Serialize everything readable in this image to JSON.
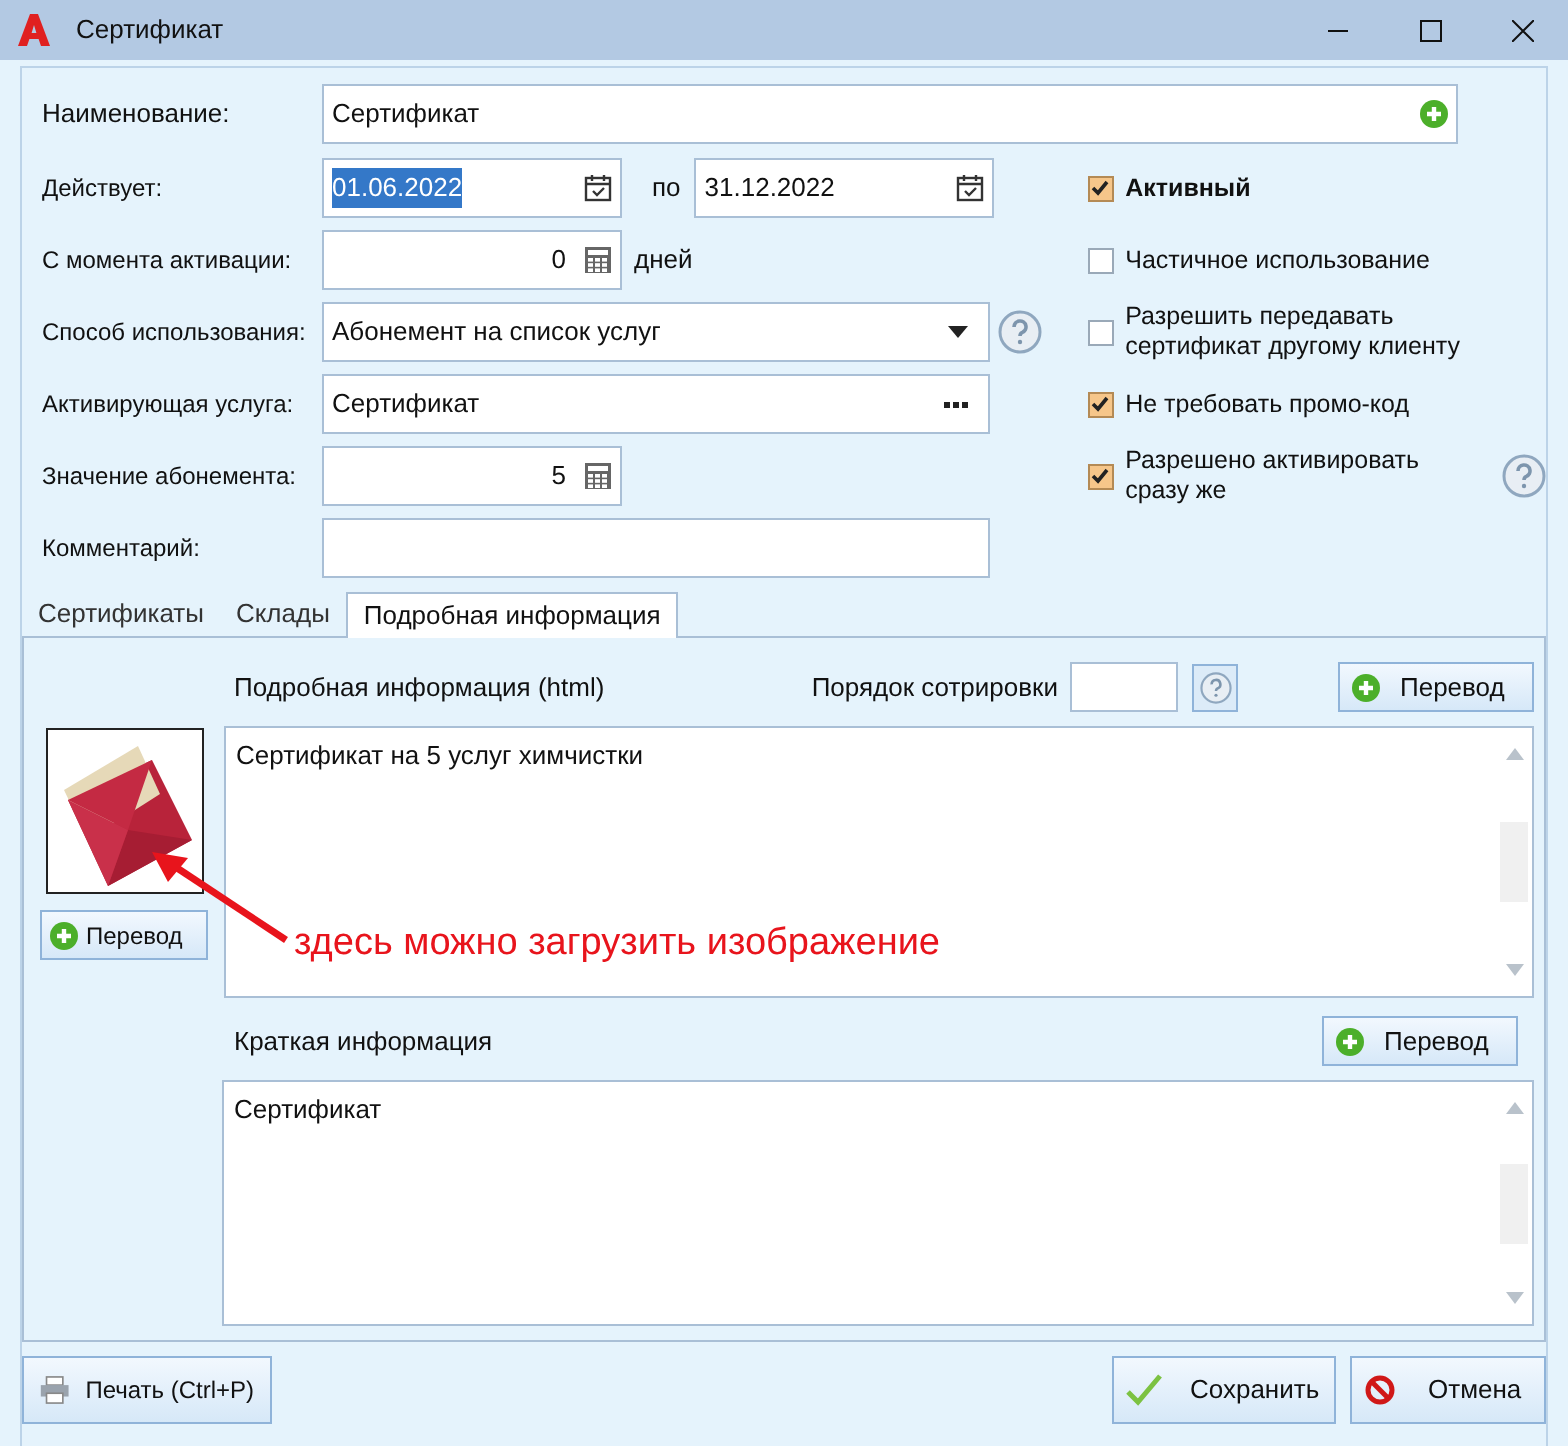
{
  "window": {
    "title": "Сертификат"
  },
  "name_field": {
    "label": "Наименование:",
    "value": "Сертификат"
  },
  "fields": [
    {
      "kind": "daterange",
      "label": "Действует:",
      "from": "01.06.2022",
      "from_highlighted": true,
      "between": "по",
      "to": "31.12.2022"
    },
    {
      "kind": "number",
      "label": "С момента активации:",
      "value": "0",
      "suffix": "дней"
    },
    {
      "kind": "select",
      "label": "Способ использования:",
      "value": "Абонемент на список услуг",
      "help": true
    },
    {
      "kind": "lookup",
      "label": "Активирующая услуга:",
      "value": "Сертификат"
    },
    {
      "kind": "number",
      "label": "Значение абонемента:",
      "value": "5"
    },
    {
      "kind": "text",
      "label": "Комментарий:"
    }
  ],
  "checkboxes": [
    {
      "label": "Активный",
      "checked": true,
      "bold": true,
      "help": false
    },
    {
      "label": "Частичное использование",
      "checked": false,
      "bold": false,
      "help": false
    },
    {
      "label": "Разрешить передавать сертификат другому клиенту",
      "checked": false,
      "bold": false,
      "help": false
    },
    {
      "label": "Не требовать промо-код",
      "checked": true,
      "bold": false,
      "help": false
    },
    {
      "label": "Разрешено активировать сразу же",
      "checked": true,
      "bold": false,
      "help": true
    }
  ],
  "tabs": [
    {
      "label": "Сертификаты",
      "selected": false
    },
    {
      "label": "Склады",
      "selected": false
    },
    {
      "label": "Подробная информация",
      "selected": true
    }
  ],
  "details": {
    "label": "Подробная информация (html)",
    "sort_label": "Порядок сотрировки",
    "translate_button": "Перевод",
    "image_button": "Перевод",
    "text": "Сертификат на 5 услуг химчистки",
    "annotation": "здесь можно загрузить изображение",
    "short_label": "Краткая информация",
    "short_translate_button": "Перевод",
    "short_text": "Сертификат"
  },
  "footer": {
    "print": "Печать (Ctrl+P)",
    "save": "Сохранить",
    "cancel": "Отмена"
  }
}
